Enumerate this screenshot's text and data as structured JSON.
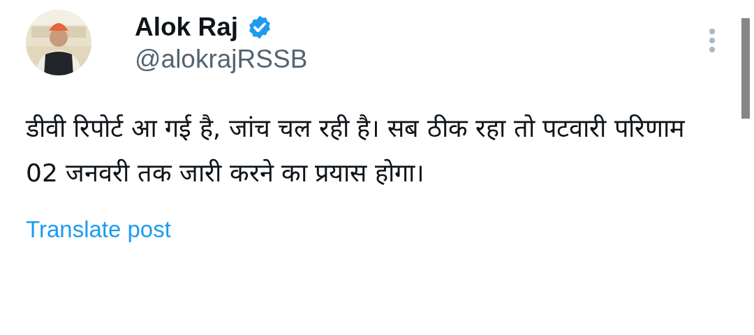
{
  "post": {
    "author": {
      "name": "Alok Raj",
      "verified": true,
      "handle": "@alokrajRSSB"
    },
    "text": "डीवी रिपोर्ट आ गई है, जांच चल रही है। सब ठीक रहा तो पटवारी परिणाम 02 जनवरी तक जारी करने का प्रयास होगा।",
    "translate_link": "Translate post"
  }
}
